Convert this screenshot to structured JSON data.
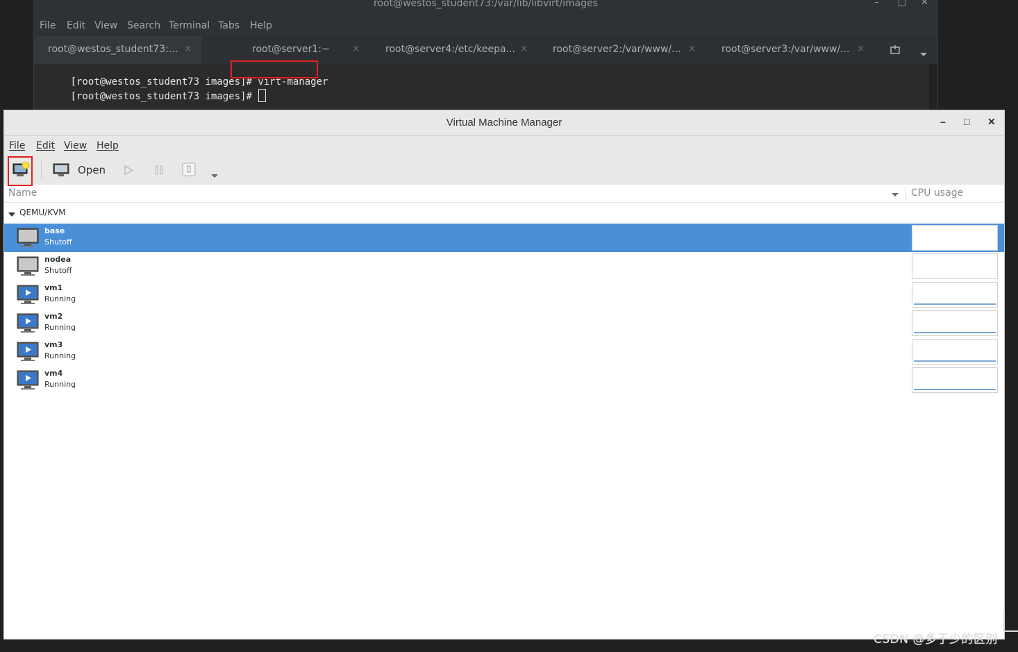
{
  "terminal": {
    "title": "root@westos_student73:/var/lib/libvirt/images",
    "window_buttons": {
      "minimize": "–",
      "maximize": "□",
      "close": "✕"
    },
    "menu": [
      "File",
      "Edit",
      "View",
      "Search",
      "Terminal",
      "Tabs",
      "Help"
    ],
    "tabs": [
      {
        "label": "root@westos_student73:...",
        "active": true
      },
      {
        "label": "root@server1:~",
        "active": false
      },
      {
        "label": "root@server4:/etc/keepa...",
        "active": false
      },
      {
        "label": "root@server2:/var/www/...",
        "active": false
      },
      {
        "label": "root@server3:/var/www/...",
        "active": false
      }
    ],
    "tab_close": "×",
    "lines": [
      {
        "prompt": "[root@westos_student73 images]# ",
        "command": "virt-manager"
      },
      {
        "prompt": "[root@westos_student73 images]# ",
        "command": ""
      }
    ],
    "highlight_color": "#e02020"
  },
  "vmm": {
    "title": "Virtual Machine Manager",
    "window_buttons": {
      "minimize": "–",
      "maximize": "□",
      "close": "✕"
    },
    "menu": [
      "File",
      "Edit",
      "View",
      "Help"
    ],
    "toolbar": {
      "new_vm_icon": "new-vm-icon",
      "open_label": "Open",
      "run_icon": "play-icon",
      "pause_icon": "pause-icon",
      "shutdown_icon": "shutdown-icon",
      "dropdown_icon": "chevron-down-icon"
    },
    "columns": {
      "name": "Name",
      "cpu": "CPU usage"
    },
    "group": "QEMU/KVM",
    "vms": [
      {
        "name": "base",
        "state": "Shutoff",
        "selected": true,
        "running": false
      },
      {
        "name": "nodea",
        "state": "Shutoff",
        "selected": false,
        "running": false
      },
      {
        "name": "vm1",
        "state": "Running",
        "selected": false,
        "running": true
      },
      {
        "name": "vm2",
        "state": "Running",
        "selected": false,
        "running": true
      },
      {
        "name": "vm3",
        "state": "Running",
        "selected": false,
        "running": true
      },
      {
        "name": "vm4",
        "state": "Running",
        "selected": false,
        "running": true
      }
    ],
    "selection_color": "#4a90d9"
  },
  "watermark": "CSDN @多于少的区别"
}
